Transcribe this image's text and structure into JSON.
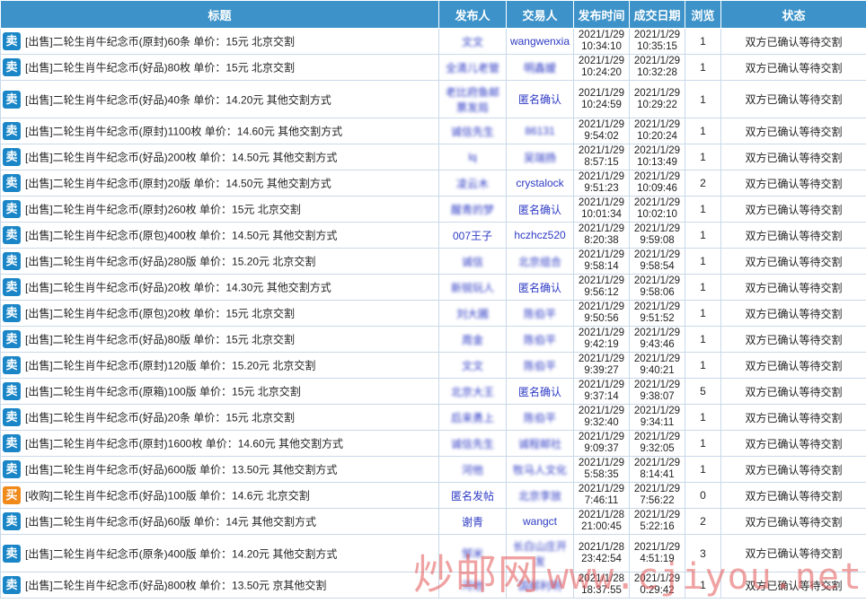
{
  "columns": [
    "标题",
    "发布人",
    "交易人",
    "发布时间",
    "成交日期",
    "浏览",
    "状态"
  ],
  "badges": {
    "sell": "卖",
    "buy": "买"
  },
  "colors": {
    "header_bg": "#3d93c9",
    "sell_badge": "#1a86c7",
    "buy_badge": "#f08a1b",
    "user_link": "#2e3bc4",
    "watermark": "#e45757"
  },
  "rows": [
    {
      "type": "sell",
      "title": "[出售]二轮生肖牛纪念币(原封)60条 单价：15元 北京交割",
      "publisher": "文文",
      "trader": "wangwenxia",
      "pub_date": "2021/1/29",
      "pub_time": "10:34:10",
      "deal_date": "2021/1/29",
      "deal_time": "10:35:15",
      "views": "1",
      "status": "双方已确认等待交割"
    },
    {
      "type": "sell",
      "title": "[出售]二轮生肖牛纪念币(好品)80枚 单价：15元 北京交割",
      "publisher": "全清儿老管",
      "trader": "明鑫嫒",
      "pub_date": "2021/1/29",
      "pub_time": "10:24:20",
      "deal_date": "2021/1/29",
      "deal_time": "10:32:28",
      "views": "1",
      "status": "双方已确认等待交割"
    },
    {
      "type": "sell",
      "title": "[出售]二轮生肖牛纪念币(好品)40条 单价：14.20元 其他交割方式",
      "publisher": "老比府鱼邮票发局",
      "trader": "匿名确认",
      "pub_date": "2021/1/29",
      "pub_time": "10:24:59",
      "deal_date": "2021/1/29",
      "deal_time": "10:29:22",
      "views": "1",
      "status": "双方已确认等待交割"
    },
    {
      "type": "sell",
      "title": "[出售]二轮生肖牛纪念币(原封)1100枚 单价：14.60元 其他交割方式",
      "publisher": "诚信先生",
      "trader": "86131",
      "pub_date": "2021/1/29",
      "pub_time": "9:54:02",
      "deal_date": "2021/1/29",
      "deal_time": "10:20:24",
      "views": "1",
      "status": "双方已确认等待交割"
    },
    {
      "type": "sell",
      "title": "[出售]二轮生肖牛纪念币(好品)200枚 单价：14.50元 其他交割方式",
      "publisher": "lq",
      "trader": "吴瑞扬",
      "pub_date": "2021/1/29",
      "pub_time": "8:57:15",
      "deal_date": "2021/1/29",
      "deal_time": "10:13:49",
      "views": "1",
      "status": "双方已确认等待交割"
    },
    {
      "type": "sell",
      "title": "[出售]二轮生肖牛纪念币(原封)20版 单价：14.50元 其他交割方式",
      "publisher": "凌云木",
      "trader": "crystalock",
      "pub_date": "2021/1/29",
      "pub_time": "9:51:23",
      "deal_date": "2021/1/29",
      "deal_time": "10:09:46",
      "views": "2",
      "status": "双方已确认等待交割"
    },
    {
      "type": "sell",
      "title": "[出售]二轮生肖牛纪念币(原封)260枚 单价：15元 北京交割",
      "publisher": "醒青的梦",
      "trader": "匿名确认",
      "pub_date": "2021/1/29",
      "pub_time": "10:01:34",
      "deal_date": "2021/1/29",
      "deal_time": "10:02:10",
      "views": "1",
      "status": "双方已确认等待交割"
    },
    {
      "type": "sell",
      "title": "[出售]二轮生肖牛纪念币(原包)400枚 单价：14.50元 其他交割方式",
      "publisher": "007王子",
      "trader": "hczhcz520",
      "pub_date": "2021/1/29",
      "pub_time": "8:20:38",
      "deal_date": "2021/1/29",
      "deal_time": "9:59:08",
      "views": "1",
      "status": "双方已确认等待交割"
    },
    {
      "type": "sell",
      "title": "[出售]二轮生肖牛纪念币(好品)280版 单价：15.20元 北京交割",
      "publisher": "诚信",
      "trader": "北京组合",
      "pub_date": "2021/1/29",
      "pub_time": "9:58:14",
      "deal_date": "2021/1/29",
      "deal_time": "9:58:54",
      "views": "1",
      "status": "双方已确认等待交割"
    },
    {
      "type": "sell",
      "title": "[出售]二轮生肖牛纪念币(好品)20枚 单价：14.30元 其他交割方式",
      "publisher": "新锐玩人",
      "trader": "匿名确认",
      "pub_date": "2021/1/29",
      "pub_time": "9:56:12",
      "deal_date": "2021/1/29",
      "deal_time": "9:58:06",
      "views": "1",
      "status": "双方已确认等待交割"
    },
    {
      "type": "sell",
      "title": "[出售]二轮生肖牛纪念币(原包)20枚 单价：15元 北京交割",
      "publisher": "刘大圃",
      "trader": "陈伯平",
      "pub_date": "2021/1/29",
      "pub_time": "9:50:56",
      "deal_date": "2021/1/29",
      "deal_time": "9:51:52",
      "views": "1",
      "status": "双方已确认等待交割"
    },
    {
      "type": "sell",
      "title": "[出售]二轮生肖牛纪念币(好品)80版 单价：15元 北京交割",
      "publisher": "周金",
      "trader": "陈伯平",
      "pub_date": "2021/1/29",
      "pub_time": "9:42:19",
      "deal_date": "2021/1/29",
      "deal_time": "9:43:46",
      "views": "1",
      "status": "双方已确认等待交割"
    },
    {
      "type": "sell",
      "title": "[出售]二轮生肖牛纪念币(原封)120版 单价：15.20元 北京交割",
      "publisher": "文文",
      "trader": "陈伯平",
      "pub_date": "2021/1/29",
      "pub_time": "9:39:27",
      "deal_date": "2021/1/29",
      "deal_time": "9:40:21",
      "views": "1",
      "status": "双方已确认等待交割"
    },
    {
      "type": "sell",
      "title": "[出售]二轮生肖牛纪念币(原箱)100版 单价：15元 北京交割",
      "publisher": "北京大王",
      "trader": "匿名确认",
      "pub_date": "2021/1/29",
      "pub_time": "9:37:14",
      "deal_date": "2021/1/29",
      "deal_time": "9:38:07",
      "views": "5",
      "status": "双方已确认等待交割"
    },
    {
      "type": "sell",
      "title": "[出售]二轮生肖牛纪念币(好品)20条 单价：15元 北京交割",
      "publisher": "后来勇上",
      "trader": "陈伯平",
      "pub_date": "2021/1/29",
      "pub_time": "9:32:40",
      "deal_date": "2021/1/29",
      "deal_time": "9:34:11",
      "views": "1",
      "status": "双方已确认等待交割"
    },
    {
      "type": "sell",
      "title": "[出售]二轮生肖牛纪念币(原封)1600枚 单价：14.60元 其他交割方式",
      "publisher": "诚信先生",
      "trader": "诚程邮社",
      "pub_date": "2021/1/29",
      "pub_time": "9:09:37",
      "deal_date": "2021/1/29",
      "deal_time": "9:32:05",
      "views": "1",
      "status": "双方已确认等待交割"
    },
    {
      "type": "sell",
      "title": "[出售]二轮生肖牛纪念币(好品)600版 单价：13.50元 其他交割方式",
      "publisher": "河他",
      "trader": "牧马人文化",
      "pub_date": "2021/1/29",
      "pub_time": "5:58:35",
      "deal_date": "2021/1/29",
      "deal_time": "8:14:41",
      "views": "1",
      "status": "双方已确认等待交割"
    },
    {
      "type": "buy",
      "title": "[收购]二轮生肖牛纪念币(好品)100版 单价：14.6元 北京交割",
      "publisher": "匿名发帖",
      "trader": "北京李放",
      "pub_date": "2021/1/29",
      "pub_time": "7:46:11",
      "deal_date": "2021/1/29",
      "deal_time": "7:56:22",
      "views": "0",
      "status": "双方已确认等待交割"
    },
    {
      "type": "sell",
      "title": "[出售]二轮生肖牛纪念币(好品)60版 单价：14元 其他交割方式",
      "publisher": "谢青",
      "trader": "wangct",
      "pub_date": "2021/1/28",
      "pub_time": "21:00:45",
      "deal_date": "2021/1/29",
      "deal_time": "5:22:16",
      "views": "2",
      "status": "双方已确认等待交割"
    },
    {
      "type": "sell",
      "title": "[出售]二轮生肖牛纪念币(原条)400版 单价：14.20元 其他交割方式",
      "publisher": "邹米",
      "trader": "长白山庄开发",
      "pub_date": "2021/1/28",
      "pub_time": "23:42:54",
      "deal_date": "2021/1/29",
      "deal_time": "4:51:19",
      "views": "3",
      "status": "双方已确认等待交割"
    },
    {
      "type": "sell",
      "title": "[出售]二轮生肖牛纪念币(好品)800枚 单价：13.50元 京其他交割",
      "publisher": "河他",
      "trader": "国邮利明",
      "pub_date": "2021/1/28",
      "pub_time": "18:37:55",
      "deal_date": "2021/1/29",
      "deal_time": "0:29:42",
      "views": "1",
      "status": "双方已确认等待交割"
    }
  ],
  "watermark": {
    "brand": "炒邮网",
    "url": "www.cjiyou.net"
  }
}
